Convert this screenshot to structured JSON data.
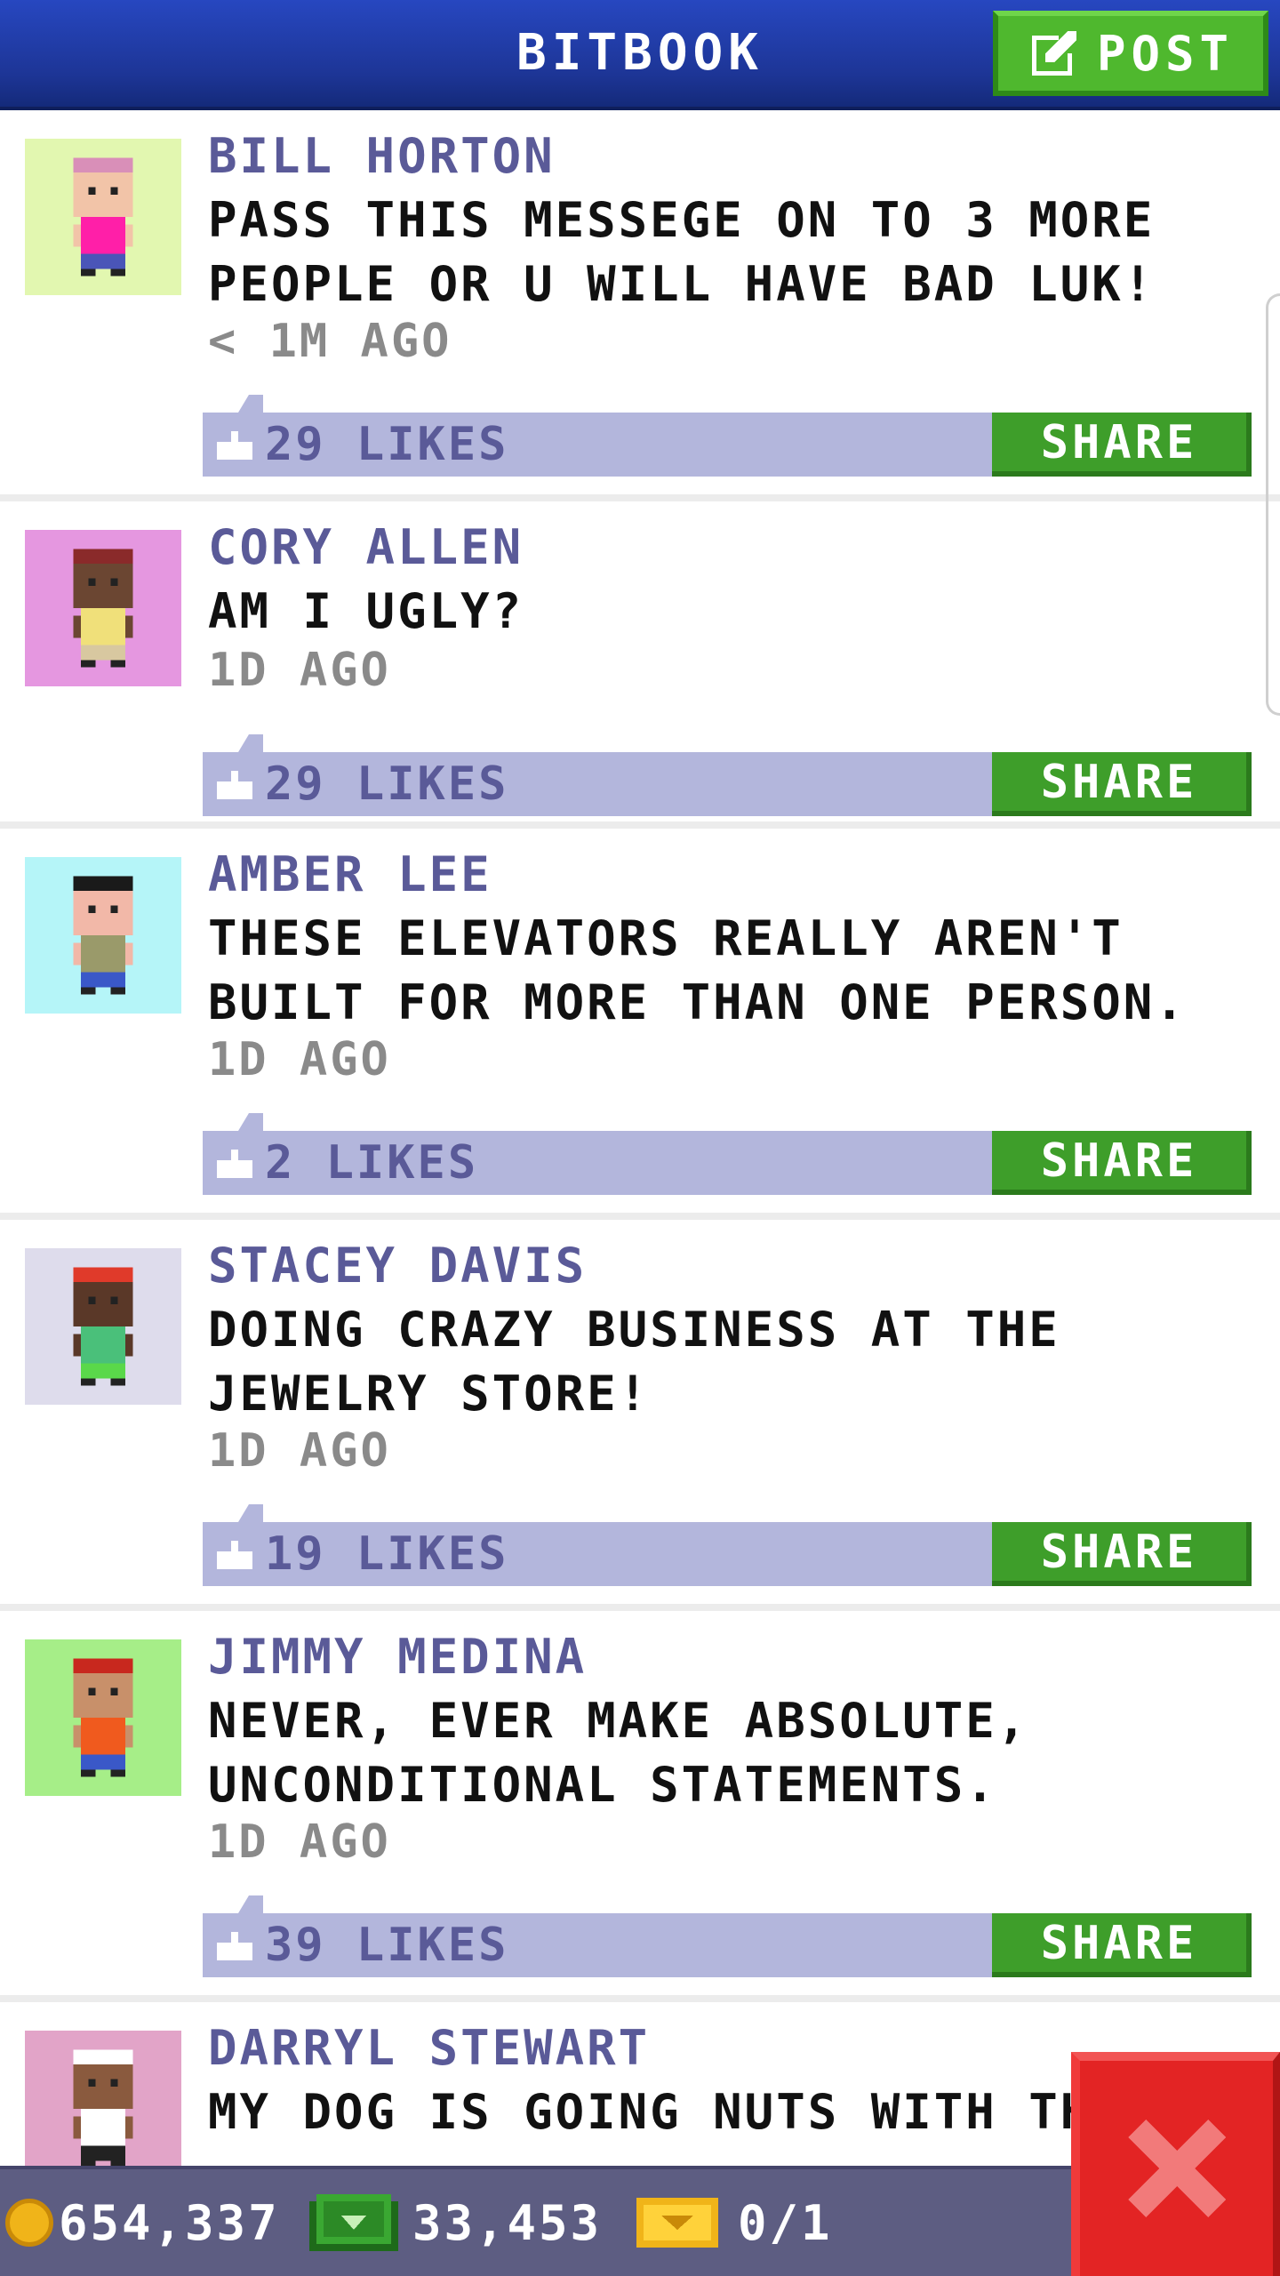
{
  "header": {
    "title": "BITBOOK",
    "post_label": "POST"
  },
  "posts": [
    {
      "author": "BILL HORTON",
      "message": "PASS THIS MESSEGE ON TO 3 MORE PEOPLE OR U WILL HAVE BAD LUK!",
      "time": "< 1M AGO",
      "likes": "29 LIKES",
      "share_label": "SHARE",
      "avatar_bg": "#e2f7b0",
      "skin": "#f2c4a8",
      "hair": "#d98fb8",
      "shirt": "#ff1fa8",
      "pants": "#4a55b8",
      "avatar_icon": "person-with-pink-cap-and-beard"
    },
    {
      "author": "CORY ALLEN",
      "message": "AM I UGLY?",
      "time": "1D AGO",
      "likes": "29 LIKES",
      "share_label": "SHARE",
      "avatar_bg": "#e597e0",
      "skin": "#6b4632",
      "hair": "#8a2a2a",
      "shirt": "#f0e07a",
      "pants": "#d8c8a0",
      "avatar_icon": "person-with-glasses"
    },
    {
      "author": "AMBER LEE",
      "message": "THESE ELEVATORS REALLY AREN'T BUILT FOR MORE THAN ONE PERSON.",
      "time": "1D AGO",
      "likes": "2 LIKES",
      "share_label": "SHARE",
      "avatar_bg": "#b5f5f8",
      "skin": "#f2b8a8",
      "hair": "#1a1a1a",
      "shirt": "#9a9a6a",
      "pants": "#3a58c8",
      "avatar_icon": "person-with-dark-hair"
    },
    {
      "author": "STACEY DAVIS",
      "message": "DOING CRAZY BUSINESS AT THE JEWELRY STORE!",
      "time": "1D AGO",
      "likes": "19 LIKES",
      "share_label": "SHARE",
      "avatar_bg": "#dedcec",
      "skin": "#5a3828",
      "hair": "#e03a2a",
      "shirt": "#4ac07a",
      "pants": "#5ad84a",
      "avatar_icon": "person-with-red-hair"
    },
    {
      "author": "JIMMY MEDINA",
      "message": "NEVER, EVER MAKE ABSOLUTE, UNCONDITIONAL STATEMENTS.",
      "time": "1D AGO",
      "likes": "39 LIKES",
      "share_label": "SHARE",
      "avatar_bg": "#a6ee88",
      "skin": "#c8906a",
      "hair": "#c8281e",
      "shirt": "#f05a1e",
      "pants": "#3a58c8",
      "avatar_icon": "person-with-red-cap"
    },
    {
      "author": "DARRYL STEWART",
      "message": "MY DOG IS GOING NUTS WITH TH",
      "time": "",
      "likes": "",
      "share_label": "",
      "avatar_bg": "#e2a4c8",
      "skin": "#8a5a3e",
      "hair": "#ffffff",
      "shirt": "#ffffff",
      "pants": "#222222",
      "avatar_icon": "person-with-chef-hat"
    }
  ],
  "footer": {
    "coins": "654,337",
    "bux": "33,453",
    "tickets": "0/1",
    "coin_icon": "coin-icon",
    "bux_icon": "cash-icon",
    "ticket_icon": "ticket-icon"
  },
  "colors": {
    "header": "#1d3596",
    "share_green": "#3e9e2a",
    "likes_bar": "#b3b6dc",
    "author_text": "#5a5a98",
    "close_red": "#e32424"
  }
}
